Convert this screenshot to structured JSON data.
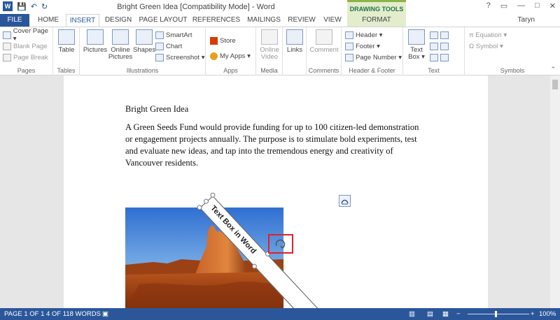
{
  "window": {
    "title": "Bright Green Idea [Compatibility Mode] - Word",
    "context_tab_group": "DRAWING TOOLS",
    "user": "Taryn",
    "controls": [
      "?",
      "▭",
      "—",
      "□",
      "✕"
    ]
  },
  "qat": {
    "app_icon": "W",
    "save_icon": "💾",
    "undo_icon": "↶",
    "redo_icon": "↻"
  },
  "tabs": [
    "FILE",
    "HOME",
    "INSERT",
    "DESIGN",
    "PAGE LAYOUT",
    "REFERENCES",
    "MAILINGS",
    "REVIEW",
    "VIEW",
    "FORMAT"
  ],
  "active_tab": "INSERT",
  "ribbon": {
    "pages": {
      "label": "Pages",
      "items": [
        "Cover Page ▾",
        "Blank Page",
        "Page Break"
      ]
    },
    "tables": {
      "label": "Tables",
      "table": "Table"
    },
    "illustrations": {
      "label": "Illustrations",
      "pictures": "Pictures",
      "online_pictures_1": "Online",
      "online_pictures_2": "Pictures",
      "shapes": "Shapes",
      "smartart": "SmartArt",
      "chart": "Chart",
      "screenshot": "Screenshot ▾"
    },
    "apps": {
      "label": "Apps",
      "store": "Store",
      "my_apps": "My Apps ▾"
    },
    "media": {
      "label": "Media",
      "online_video_1": "Online",
      "online_video_2": "Video"
    },
    "links": {
      "label": "",
      "links": "Links"
    },
    "comments": {
      "label": "Comments",
      "comment": "Comment"
    },
    "header_footer": {
      "label": "Header & Footer",
      "header": "Header ▾",
      "footer": "Footer ▾",
      "page_number": "Page Number ▾"
    },
    "text": {
      "label": "Text",
      "text_box_1": "Text",
      "text_box_2": "Box ▾"
    },
    "symbols": {
      "label": "Symbols",
      "equation": "π Equation ▾",
      "symbol": "Ω Symbol ▾"
    }
  },
  "document": {
    "heading": "Bright Green Idea",
    "body": "A Green Seeds Fund would provide funding for up to 100 citizen-led demonstration or engagement projects annually. The purpose is to stimulate bold experiments, test and evaluate new ideas, and tap into the tremendous energy and creativity of Vancouver residents.",
    "textbox_text": "Text Box in Word"
  },
  "statusbar": {
    "page": "PAGE 1 OF 1",
    "words": "4 OF 118 WORDS",
    "zoom": "100%",
    "zoom_level_pct": 100
  }
}
